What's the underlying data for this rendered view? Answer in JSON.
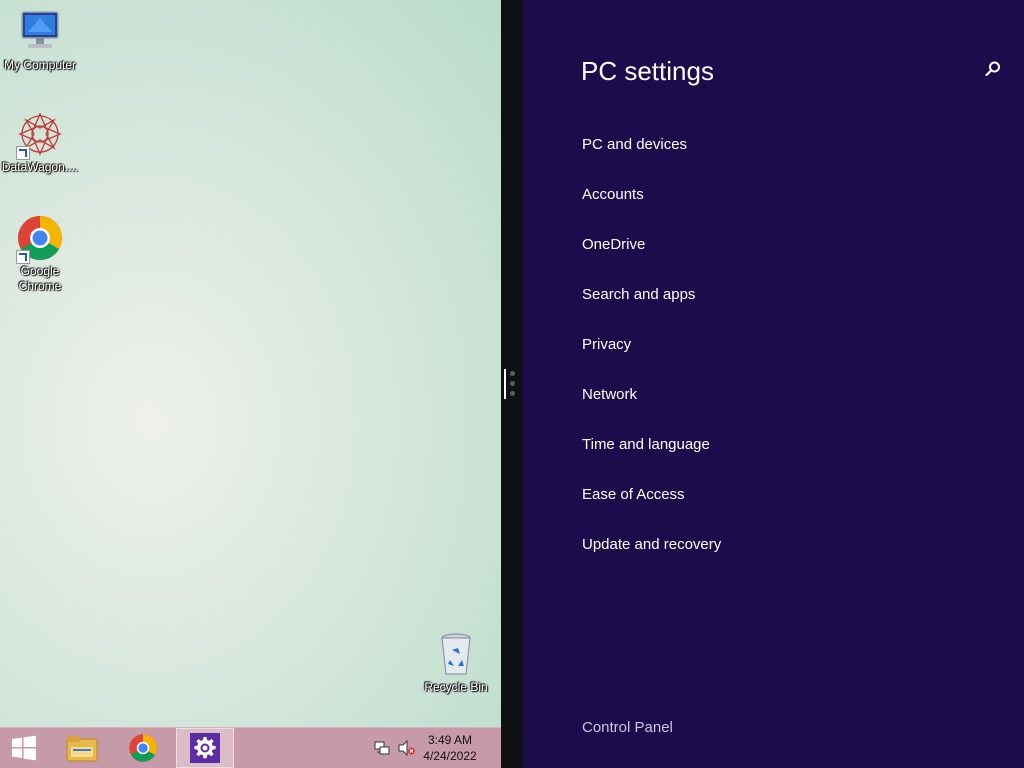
{
  "desktop": {
    "icons": [
      {
        "label": "My Computer",
        "icon": "computer-icon"
      },
      {
        "label": "DataWagon....",
        "icon": "datawagon-icon"
      },
      {
        "label": "Google Chrome",
        "icon": "chrome-icon"
      },
      {
        "label": "Recycle Bin",
        "icon": "recycle-bin-icon"
      }
    ]
  },
  "taskbar": {
    "items": [
      "start-icon",
      "file-explorer-icon",
      "chrome-icon",
      "settings-icon"
    ],
    "clock": {
      "time": "3:49 AM",
      "date": "4/24/2022"
    }
  },
  "settings": {
    "title": "PC settings",
    "items": [
      {
        "label": "PC and devices"
      },
      {
        "label": "Accounts"
      },
      {
        "label": "OneDrive"
      },
      {
        "label": "Search and apps"
      },
      {
        "label": "Privacy"
      },
      {
        "label": "Network"
      },
      {
        "label": "Time and language"
      },
      {
        "label": "Ease of Access"
      },
      {
        "label": "Update and recovery"
      }
    ],
    "control_panel": "Control Panel"
  },
  "colors": {
    "settings_bg": "#1c0c4c",
    "taskbar_bg": "#c79aa9",
    "accent": "#5b2ea6"
  }
}
